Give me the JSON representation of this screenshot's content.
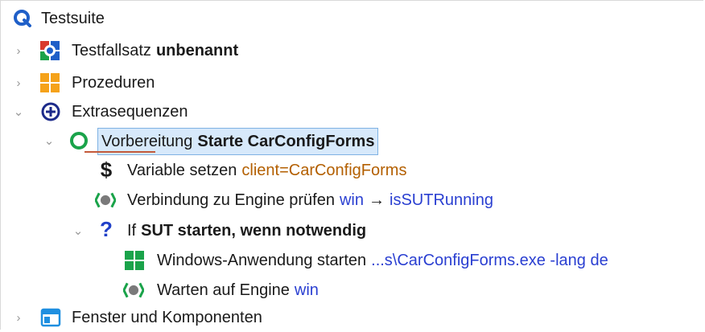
{
  "tree": {
    "root": {
      "label": "Testsuite",
      "icon": "q-logo-icon"
    },
    "testset": {
      "label": "Testfallsatz",
      "name": "unbenannt",
      "icon": "testset-icon"
    },
    "procedures": {
      "label": "Prozeduren",
      "icon": "procedures-icon"
    },
    "extras": {
      "label": "Extrasequenzen",
      "icon": "plus-circle-icon"
    },
    "setup": {
      "label": "Vorbereitung",
      "name": "Starte CarConfigForms",
      "icon": "setup-circle-icon"
    },
    "setvar": {
      "label": "Variable setzen",
      "value": "client=CarConfigForms",
      "icon": "dollar-icon"
    },
    "check": {
      "label": "Verbindung zu Engine prüfen",
      "value_a": "win",
      "arrow": "→",
      "value_b": "isSUTRunning",
      "icon": "engine-check-icon"
    },
    "ifnode": {
      "label": "If",
      "name": "SUT starten, wenn notwendig",
      "icon": "question-icon"
    },
    "startapp": {
      "label": "Windows-Anwendung starten",
      "value": "...s\\CarConfigForms.exe -lang de",
      "icon": "windows-icon"
    },
    "wait": {
      "label": "Warten auf Engine",
      "value": "win",
      "icon": "engine-wait-icon"
    },
    "windows": {
      "label": "Fenster und Komponenten",
      "icon": "window-icon"
    }
  },
  "colors": {
    "accent_blue": "#2a3fd1",
    "value_orange": "#b35f00",
    "selection": "#d7e9fb",
    "green": "#1aa34a"
  }
}
